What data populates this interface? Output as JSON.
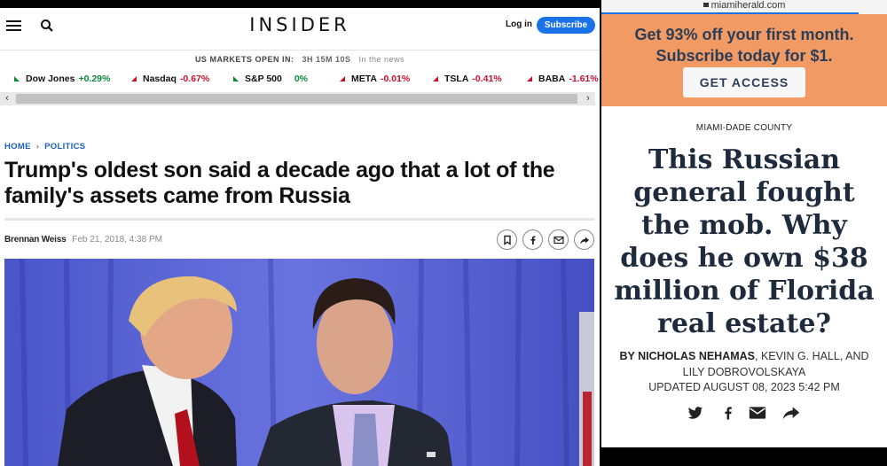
{
  "insider": {
    "logo": "INSIDER",
    "login_label": "Log in",
    "subscribe_label": "Subscribe",
    "markets": {
      "status": "US MARKETS OPEN IN:",
      "countdown": "3H 15M 10S",
      "in_the_news": "In the news"
    },
    "tickers": [
      {
        "name": "Dow Jones",
        "change": "+0.29%",
        "direction": "up"
      },
      {
        "name": "Nasdaq",
        "change": "-0.67%",
        "direction": "down"
      },
      {
        "name": "S&P 500",
        "change": "0%",
        "direction": "up"
      },
      {
        "name": "META",
        "change": "-0.01%",
        "direction": "down"
      },
      {
        "name": "TSLA",
        "change": "-0.41%",
        "direction": "down"
      },
      {
        "name": "BABA",
        "change": "-1.61%",
        "direction": "down"
      }
    ],
    "breadcrumbs": [
      "HOME",
      "POLITICS"
    ],
    "headline": "Trump's oldest son said a decade ago that a lot of the family's assets came from Russia",
    "author": "Brennan Weiss",
    "date": "Feb 21, 2018, 4:38 PM",
    "share_icons": [
      "bookmark-icon",
      "facebook-icon",
      "email-icon",
      "share-icon"
    ],
    "colors": {
      "accent": "#1a72e8",
      "positive": "#0a8a3a",
      "negative": "#c8102e"
    }
  },
  "miami": {
    "url": "miamiherald.com",
    "promo_text": "Get 93% off your first month. Subscribe today for $1.",
    "promo_button": "GET ACCESS",
    "section": "MIAMI-DADE COUNTY",
    "headline": "This Russian general fought the mob. Why does he own $38 million of Florida real estate?",
    "byline_lead": "BY NICHOLAS NEHAMAS",
    "byline_rest": ", KEVIN G. HALL, AND LILY DOBROVOLSKAYA",
    "updated": "UPDATED AUGUST 08, 2023 5:42 PM",
    "share_icons": [
      "twitter-icon",
      "facebook-icon",
      "email-icon",
      "share-icon"
    ],
    "colors": {
      "promo_bg": "#f29a63",
      "headline": "#1d2b3d"
    }
  }
}
